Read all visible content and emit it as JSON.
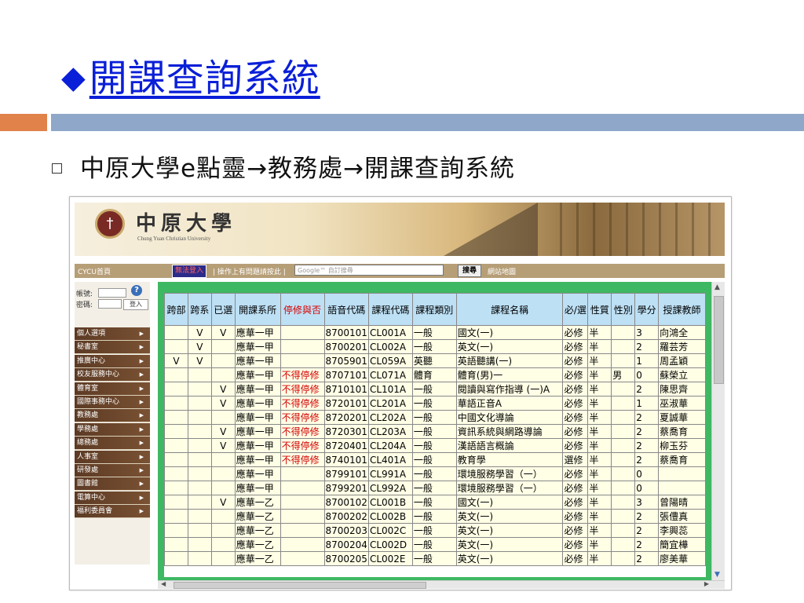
{
  "slide": {
    "title_symbol": "◆",
    "title": "開課查詢系統",
    "bullet_text": "中原大學e點靈→教務處→開課查詢系統"
  },
  "site": {
    "logo_seal_text": "†",
    "logo_name": "中原大學",
    "logo_sub": "Chung Yuan Christian University"
  },
  "navbar": {
    "home": "CYCU首頁",
    "login_issue": "無法登入",
    "help_text": "| 操作上有問題請按此 |",
    "search_placeholder": "Google™ 自訂搜尋",
    "search_button": "搜尋",
    "sitemap": "網站地圖"
  },
  "sidebar": {
    "account_label": "帳號:",
    "password_label": "密碼:",
    "login_button": "登入",
    "help_icon": "?",
    "menu": [
      "個人選項",
      "秘書室",
      "推廣中心",
      "校友服務中心",
      "體育室",
      "國際事務中心",
      "教務處",
      "學務處",
      "總務處",
      "人事室",
      "研發處",
      "圖書館",
      "電算中心",
      "福利委員會"
    ]
  },
  "table": {
    "headers": [
      "跨部",
      "跨系",
      "已選",
      "開課系所",
      "停修與否",
      "語音代碼",
      "課程代碼",
      "課程類別",
      "課程名稱",
      "必/選",
      "性質",
      "性別",
      "學分",
      "授課教師"
    ],
    "rows": [
      [
        "",
        "V",
        "V",
        "應華一甲",
        "",
        "8700101",
        "CL001A",
        "一般",
        "國文(一)",
        "必修",
        "半",
        "",
        "3",
        "向鴻全"
      ],
      [
        "",
        "V",
        "",
        "應華一甲",
        "",
        "8700201",
        "CL002A",
        "一般",
        "英文(一)",
        "必修",
        "半",
        "",
        "2",
        "羅芸芳"
      ],
      [
        "V",
        "V",
        "",
        "應華一甲",
        "",
        "8705901",
        "CL059A",
        "英聽",
        "英語聽講(一)",
        "必修",
        "半",
        "",
        "1",
        "周孟穎"
      ],
      [
        "",
        "",
        "",
        "應華一甲",
        "不得停修",
        "8707101",
        "CL071A",
        "體育",
        "體育(男)一",
        "必修",
        "半",
        "男",
        "0",
        "蘇榮立"
      ],
      [
        "",
        "",
        "V",
        "應華一甲",
        "不得停修",
        "8710101",
        "CL101A",
        "一般",
        "閱讀與寫作指導 (一)A",
        "必修",
        "半",
        "",
        "2",
        "陳思齊"
      ],
      [
        "",
        "",
        "V",
        "應華一甲",
        "不得停修",
        "8720101",
        "CL201A",
        "一般",
        "華語正音A",
        "必修",
        "半",
        "",
        "1",
        "巫淑華"
      ],
      [
        "",
        "",
        "",
        "應華一甲",
        "不得停修",
        "8720201",
        "CL202A",
        "一般",
        "中國文化導論",
        "必修",
        "半",
        "",
        "2",
        "夏誠華"
      ],
      [
        "",
        "",
        "V",
        "應華一甲",
        "不得停修",
        "8720301",
        "CL203A",
        "一般",
        "資訊系統與網路導論",
        "必修",
        "半",
        "",
        "2",
        "蔡喬育"
      ],
      [
        "",
        "",
        "V",
        "應華一甲",
        "不得停修",
        "8720401",
        "CL204A",
        "一般",
        "漢語語言概論",
        "必修",
        "半",
        "",
        "2",
        "柳玉芬"
      ],
      [
        "",
        "",
        "",
        "應華一甲",
        "不得停修",
        "8740101",
        "CL401A",
        "一般",
        "教育學",
        "選修",
        "半",
        "",
        "2",
        "蔡喬育"
      ],
      [
        "",
        "",
        "",
        "應華一甲",
        "",
        "8799101",
        "CL991A",
        "一般",
        "環境服務學習（一）",
        "必修",
        "半",
        "",
        "0",
        ""
      ],
      [
        "",
        "",
        "",
        "應華一甲",
        "",
        "8799201",
        "CL992A",
        "一般",
        "環境服務學習（一）",
        "必修",
        "半",
        "",
        "0",
        ""
      ],
      [
        "",
        "",
        "V",
        "應華一乙",
        "",
        "8700102",
        "CL001B",
        "一般",
        "國文(一)",
        "必修",
        "半",
        "",
        "3",
        "曾陽晴"
      ],
      [
        "",
        "",
        "",
        "應華一乙",
        "",
        "8700202",
        "CL002B",
        "一般",
        "英文(一)",
        "必修",
        "半",
        "",
        "2",
        "張僼真"
      ],
      [
        "",
        "",
        "",
        "應華一乙",
        "",
        "8700203",
        "CL002C",
        "一般",
        "英文(一)",
        "必修",
        "半",
        "",
        "2",
        "李興蕊"
      ],
      [
        "",
        "",
        "",
        "應華一乙",
        "",
        "8700204",
        "CL002D",
        "一般",
        "英文(一)",
        "必修",
        "半",
        "",
        "2",
        "簡宜樺"
      ],
      [
        "",
        "",
        "",
        "應華一乙",
        "",
        "8700205",
        "CL002E",
        "一般",
        "英文(一)",
        "必修",
        "半",
        "",
        "2",
        "廖美華"
      ]
    ]
  },
  "colors": {
    "title_blue": "#0a1fd8",
    "rule_orange": "#e0824a",
    "rule_blue": "#8fa8c9",
    "frame_green": "#3fb863",
    "header_blue": "#bde0f5",
    "cell_yellow": "#ffffe6",
    "warning_red": "#d40000"
  }
}
